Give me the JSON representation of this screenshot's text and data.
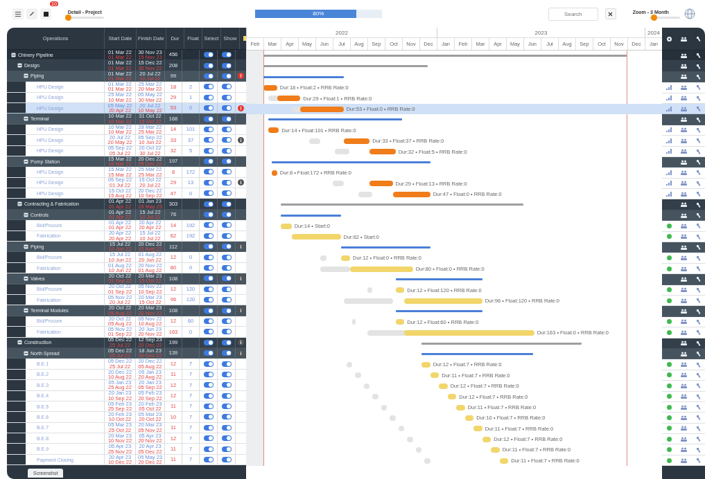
{
  "toolbar": {
    "notification_count": "10",
    "detail": {
      "label": "Detail - Project",
      "level": 0
    },
    "progress": {
      "text": "80%",
      "level": 0.8
    },
    "search": {
      "placeholder": "Search"
    },
    "zoom": {
      "label": "Zoom - 3 Month",
      "level": 0.15
    }
  },
  "columns": [
    "Operations",
    "Start Date",
    "Finish Date",
    "Dur",
    "Float",
    "Select",
    "Show"
  ],
  "timeline": [
    {
      "label": "2022",
      "months": [
        "Feb",
        "Mar",
        "Apr",
        "May",
        "Jun",
        "Jul",
        "Aug",
        "Sep",
        "Oct",
        "Nov",
        "Dec"
      ]
    },
    {
      "label": "2023",
      "months": [
        "Jan",
        "Feb",
        "Mar",
        "Apr",
        "May",
        "Jun",
        "Jul",
        "Aug",
        "Sep",
        "Oct",
        "Nov",
        "Dec"
      ]
    },
    {
      "label": "2024",
      "months": [
        "Jan"
      ]
    }
  ],
  "rows": [
    {
      "kind": "group",
      "name": "Chinery Pipeline",
      "expanded": true,
      "selected": false,
      "start": "01 Mar 22",
      "start_base": "01 Mar 22",
      "finish": "30 Nov 23",
      "finish_base": "15 Nov 23",
      "dur": "456",
      "select": true,
      "show": true,
      "children": [
        {
          "kind": "group",
          "name": "Design",
          "expanded": true,
          "selected": false,
          "start": "01 Mar 22",
          "start_base": "01 Mar 22",
          "finish": "15 Dec 22",
          "finish_base": "30 Nov 22",
          "dur": "208",
          "select": true,
          "show": true,
          "children": [
            {
              "kind": "group",
              "name": "Piping",
              "expanded": true,
              "selected": false,
              "start": "01 Mar 22",
              "start_base": "01 Mar 22",
              "finish": "20 Jul 22",
              "finish_base": "10 Jul 22",
              "dur": "99",
              "select": true,
              "show": true,
              "badge": {
                "kind": "alert"
              },
              "children": [
                {
                  "kind": "task",
                  "name": "HPU Design",
                  "selected": false,
                  "start": "01 Mar 22",
                  "start_base": "01 Mar 22",
                  "finish": "25 Mar 22",
                  "finish_base": "20 Mar 22",
                  "dur": "18",
                  "float": "2",
                  "select": true,
                  "show": true,
                  "approved": false,
                  "color": "#f07c1a",
                  "bar_label": "Dur:18 • Float:2 • RRB Rate:0"
                },
                {
                  "kind": "task",
                  "name": "HPU Design",
                  "selected": false,
                  "start": "25 Mar 22",
                  "start_base": "10 Mar 22",
                  "finish": "05 May 22",
                  "finish_base": "30 Mar 22",
                  "dur": "29",
                  "float": "1",
                  "select": true,
                  "show": true,
                  "approved": false,
                  "color": "#f07c1a",
                  "bar_label": "Dur:29 • Float:1 • RRB Rate:0"
                },
                {
                  "kind": "task",
                  "name": "HPU Design",
                  "selected": true,
                  "start": "05 May 22",
                  "start_base": "20 Apr 22",
                  "finish": "20 Jul 22",
                  "finish_base": "10 May 22",
                  "dur": "53",
                  "float": "0",
                  "select": true,
                  "show": true,
                  "approved": false,
                  "badge": {
                    "kind": "alert"
                  },
                  "color": "#f07c1a",
                  "bar_label": "Dur:53 • Float:0 • RRB Rate:0"
                }
              ]
            },
            {
              "kind": "group",
              "name": "Terminal",
              "expanded": true,
              "selected": false,
              "start": "10 Mar 22",
              "start_base": "10 Mar 22",
              "finish": "31 Oct 22",
              "finish_base": "15 Oct 22",
              "dur": "168",
              "select": true,
              "show": true,
              "children": [
                {
                  "kind": "task",
                  "name": "HPU Design",
                  "selected": false,
                  "start": "10 Mar 22",
                  "start_base": "10 Mar 22",
                  "finish": "28 Mar 22",
                  "finish_base": "25 Mar 22",
                  "dur": "14",
                  "float": "101",
                  "select": true,
                  "show": true,
                  "approved": false,
                  "color": "#f07c1a",
                  "bar_label": "Dur:14 • Float:101 • RRB Rate:0"
                },
                {
                  "kind": "task",
                  "name": "HPU Design",
                  "selected": false,
                  "start": "20 Jul 22",
                  "start_base": "20 May 22",
                  "finish": "05 Sep 22",
                  "finish_base": "10 Jun 22",
                  "dur": "33",
                  "float": "37",
                  "select": true,
                  "show": true,
                  "approved": false,
                  "badge": {
                    "kind": "info"
                  },
                  "color": "#f07c1a",
                  "bar_label": "Dur:33 • Float:37 • RRB Rate:0"
                },
                {
                  "kind": "task",
                  "name": "HPU Design",
                  "selected": false,
                  "start": "05 Sep 22",
                  "start_base": "05 Jul 22",
                  "finish": "20 Oct 22",
                  "finish_base": "30 Jul 22",
                  "dur": "32",
                  "float": "5",
                  "select": true,
                  "show": true,
                  "approved": false,
                  "color": "#f07c1a",
                  "bar_label": "Dur:32 • Float:5 • RRB Rate:0"
                }
              ]
            },
            {
              "kind": "group",
              "name": "Pump Station",
              "expanded": true,
              "selected": false,
              "start": "15 Mar 22",
              "start_base": "15 Mar 22",
              "finish": "20 Dec 22",
              "finish_base": "05 Dec 22",
              "dur": "197",
              "select": true,
              "show": true,
              "children": [
                {
                  "kind": "task",
                  "name": "HPU Design",
                  "selected": false,
                  "start": "15 Mar 22",
                  "start_base": "15 Mar 22",
                  "finish": "25 Mar 22",
                  "finish_base": "25 Mar 22",
                  "dur": "8",
                  "float": "172",
                  "select": true,
                  "show": true,
                  "approved": false,
                  "color": "#f07c1a",
                  "bar_label": "Dur:8 • Float:172 • RRB Rate:0"
                },
                {
                  "kind": "task",
                  "name": "HPU Design",
                  "selected": false,
                  "start": "05 Sep 22",
                  "start_base": "01 Jul 22",
                  "finish": "15 Oct 22",
                  "finish_base": "20 Jul 22",
                  "dur": "29",
                  "float": "13",
                  "select": true,
                  "show": true,
                  "approved": false,
                  "badge": {
                    "kind": "info"
                  },
                  "color": "#f07c1a",
                  "bar_label": "Dur:29 • Float:13 • RRB Rate:0"
                },
                {
                  "kind": "task",
                  "name": "HPU Design",
                  "selected": false,
                  "start": "15 Oct 22",
                  "start_base": "15 Aug 22",
                  "finish": "20 Dec 22",
                  "finish_base": "10 Sep 22",
                  "dur": "47",
                  "float": "0",
                  "select": true,
                  "show": true,
                  "approved": false,
                  "color": "#f07c1a",
                  "bar_label": "Dur:47 • Float:0 • RRB Rate:0"
                }
              ]
            }
          ]
        },
        {
          "kind": "group",
          "name": "Contracting & Fabrication",
          "expanded": true,
          "selected": false,
          "start": "01 Apr 22",
          "start_base": "01 Apr 22",
          "finish": "01 Jun 23",
          "finish_base": "15 May 23",
          "dur": "303",
          "select": true,
          "show": true,
          "children": [
            {
              "kind": "group",
              "name": "Controls",
              "expanded": true,
              "selected": false,
              "start": "01 Apr 22",
              "start_base": "01 Apr 22",
              "finish": "15 Jul 22",
              "finish_base": "10 Jul 22",
              "dur": "76",
              "select": true,
              "show": true,
              "children": [
                {
                  "kind": "task",
                  "name": "Bid/Procure",
                  "selected": false,
                  "start": "01 Apr 22",
                  "start_base": "01 Apr 22",
                  "finish": "20 Apr 22",
                  "finish_base": "20 Apr 22",
                  "dur": "14",
                  "float": "192",
                  "select": true,
                  "show": true,
                  "approved": true,
                  "color": "#f2d66b",
                  "bar_label": "Dur:14 • Start:0"
                },
                {
                  "kind": "task",
                  "name": "Fabrication",
                  "selected": false,
                  "start": "20 Apr 22",
                  "start_base": "20 Apr 22",
                  "finish": "15 Jul 22",
                  "finish_base": "10 Jul 22",
                  "dur": "62",
                  "float": "192",
                  "select": true,
                  "show": true,
                  "approved": true,
                  "color": "#f2d66b",
                  "bar_label": "Dur:62 • Start:0"
                }
              ]
            },
            {
              "kind": "group",
              "name": "Piping",
              "expanded": true,
              "selected": false,
              "start": "15 Jul 22",
              "start_base": "10 Jun 22",
              "finish": "20 Dec 22",
              "finish_base": "01 Aug 22",
              "dur": "112",
              "select": true,
              "show": true,
              "badge": {
                "kind": "info"
              },
              "children": [
                {
                  "kind": "task",
                  "name": "Bid/Procure",
                  "selected": false,
                  "start": "15 Jul 22",
                  "start_base": "10 Jun 22",
                  "finish": "01 Aug 22",
                  "finish_base": "20 Jun 22",
                  "dur": "12",
                  "float": "0",
                  "select": true,
                  "show": true,
                  "approved": true,
                  "color": "#f2d66b",
                  "bar_label": "Dur:12 • Float:0 • RRB Rate:0"
                },
                {
                  "kind": "task",
                  "name": "Fabrication",
                  "selected": false,
                  "start": "01 Aug 22",
                  "start_base": "10 Jun 22",
                  "finish": "20 Nov 22",
                  "finish_base": "01 Aug 22",
                  "dur": "80",
                  "float": "0",
                  "select": true,
                  "show": true,
                  "approved": true,
                  "color": "#f2d66b",
                  "bar_label": "Dur:80 • Float:0 • RRB Rate:0"
                }
              ]
            },
            {
              "kind": "group",
              "name": "Valves",
              "expanded": true,
              "selected": false,
              "start": "20 Oct 22",
              "start_base": "01 Sep 22",
              "finish": "20 Mar 23",
              "finish_base": "15 Oct 22",
              "dur": "108",
              "select": true,
              "show": true,
              "badge": {
                "kind": "info"
              },
              "children": [
                {
                  "kind": "task",
                  "name": "Bid/Procure",
                  "selected": false,
                  "start": "20 Oct 22",
                  "start_base": "01 Sep 22",
                  "finish": "05 Nov 22",
                  "finish_base": "10 Sep 22",
                  "dur": "12",
                  "float": "120",
                  "select": true,
                  "show": true,
                  "approved": true,
                  "color": "#f2d66b",
                  "bar_label": "Dur:12 • Float:120 • RRB Rate:0"
                },
                {
                  "kind": "task",
                  "name": "Fabrication",
                  "selected": false,
                  "start": "05 Nov 22",
                  "start_base": "20 Jul 22",
                  "finish": "20 Mar 23",
                  "finish_base": "15 Oct 22",
                  "dur": "96",
                  "float": "120",
                  "select": true,
                  "show": true,
                  "approved": true,
                  "color": "#f2d66b",
                  "bar_label": "Dur:96 • Float:120 • RRB Rate:0"
                }
              ]
            },
            {
              "kind": "group",
              "name": "Terminal Modules",
              "expanded": true,
              "selected": false,
              "start": "20 Oct 22",
              "start_base": "05 Aug 22",
              "finish": "20 Mar 23",
              "finish_base": "20 Nov 22",
              "dur": "108",
              "select": true,
              "show": true,
              "badge": {
                "kind": "info"
              },
              "children": [
                {
                  "kind": "task",
                  "name": "Bid/Procure",
                  "selected": false,
                  "start": "20 Oct 22",
                  "start_base": "05 Aug 22",
                  "finish": "05 Nov 22",
                  "finish_base": "10 Aug 22",
                  "dur": "12",
                  "float": "60",
                  "select": true,
                  "show": true,
                  "approved": true,
                  "color": "#f2d66b",
                  "bar_label": "Dur:12 • Float:60 • RRB Rate:0"
                },
                {
                  "kind": "task",
                  "name": "Fabrication",
                  "selected": false,
                  "start": "05 Nov 22",
                  "start_base": "01 Sep 22",
                  "finish": "20 Jun 23",
                  "finish_base": "20 Nov 22",
                  "dur": "163",
                  "float": "0",
                  "select": true,
                  "show": true,
                  "approved": true,
                  "color": "#f2d66b",
                  "bar_label": "Dur:163 • Float:0 • RRB Rate:0"
                }
              ]
            }
          ]
        },
        {
          "kind": "group",
          "name": "Construction",
          "expanded": true,
          "selected": false,
          "start": "05 Dec 22",
          "start_base": "25 Jul 22",
          "finish": "12 Sep 23",
          "finish_base": "20 Dec 22",
          "dur": "199",
          "select": true,
          "show": true,
          "badge": {
            "kind": "info"
          },
          "children": [
            {
              "kind": "group",
              "name": "North Spread",
              "expanded": true,
              "selected": false,
              "start": "05 Dec 22",
              "start_base": "25 Jul 22",
              "finish": "18 Jun 23",
              "finish_base": "20 Dec 22",
              "dur": "139",
              "select": true,
              "show": true,
              "badge": {
                "kind": "info"
              },
              "children": [
                {
                  "kind": "task",
                  "name": "B.E.1",
                  "selected": false,
                  "start": "05 Dec 22",
                  "start_base": "25 Jul 22",
                  "finish": "20 Dec 22",
                  "finish_base": "05 Aug 22",
                  "dur": "12",
                  "float": "7",
                  "select": true,
                  "show": true,
                  "approved": true,
                  "color": "#f2d66b",
                  "bar_label": "Dur:12 • Float:7 • RRB Rate:0"
                },
                {
                  "kind": "task",
                  "name": "B.E.2",
                  "selected": false,
                  "start": "20 Dec 22",
                  "start_base": "10 Aug 22",
                  "finish": "05 Jan 23",
                  "finish_base": "20 Aug 22",
                  "dur": "11",
                  "float": "7",
                  "select": true,
                  "show": true,
                  "approved": true,
                  "color": "#f2d66b",
                  "bar_label": "Dur:11 • Float:7 • RRB Rate:0"
                },
                {
                  "kind": "task",
                  "name": "B.E.3",
                  "selected": false,
                  "start": "05 Jan 23",
                  "start_base": "25 Aug 22",
                  "finish": "20 Jan 23",
                  "finish_base": "05 Sep 22",
                  "dur": "12",
                  "float": "7",
                  "select": true,
                  "show": true,
                  "approved": true,
                  "color": "#f2d66b",
                  "bar_label": "Dur:12 • Float:7 • RRB Rate:0"
                },
                {
                  "kind": "task",
                  "name": "B.E.4",
                  "selected": false,
                  "start": "20 Jan 23",
                  "start_base": "10 Sep 22",
                  "finish": "05 Feb 23",
                  "finish_base": "20 Sep 22",
                  "dur": "12",
                  "float": "7",
                  "select": true,
                  "show": true,
                  "approved": true,
                  "color": "#f2d66b",
                  "bar_label": "Dur:12 • Float:7 • RRB Rate:0"
                },
                {
                  "kind": "task",
                  "name": "B.E.5",
                  "selected": false,
                  "start": "05 Feb 23",
                  "start_base": "25 Sep 22",
                  "finish": "20 Feb 23",
                  "finish_base": "05 Oct 22",
                  "dur": "11",
                  "float": "7",
                  "select": true,
                  "show": true,
                  "approved": true,
                  "color": "#f2d66b",
                  "bar_label": "Dur:11 • Float:7 • RRB Rate:0"
                },
                {
                  "kind": "task",
                  "name": "B.E.6",
                  "selected": false,
                  "start": "20 Feb 23",
                  "start_base": "10 Oct 22",
                  "finish": "05 Mar 23",
                  "finish_base": "20 Oct 22",
                  "dur": "10",
                  "float": "7",
                  "select": true,
                  "show": true,
                  "approved": true,
                  "color": "#f2d66b",
                  "bar_label": "Dur:10 • Float:7 • RRB Rate:0"
                },
                {
                  "kind": "task",
                  "name": "B.E.7",
                  "selected": false,
                  "start": "05 Mar 23",
                  "start_base": "25 Oct 22",
                  "finish": "20 Mar 23",
                  "finish_base": "05 Nov 22",
                  "dur": "11",
                  "float": "7",
                  "select": true,
                  "show": true,
                  "approved": true,
                  "color": "#f2d66b",
                  "bar_label": "Dur:11 • Float:7 • RRB Rate:0"
                },
                {
                  "kind": "task",
                  "name": "B.E.8",
                  "selected": false,
                  "start": "20 Mar 23",
                  "start_base": "10 Nov 22",
                  "finish": "05 Apr 23",
                  "finish_base": "20 Nov 22",
                  "dur": "12",
                  "float": "7",
                  "select": true,
                  "show": true,
                  "approved": true,
                  "color": "#f2d66b",
                  "bar_label": "Dur:12 • Float:7 • RRB Rate:0"
                },
                {
                  "kind": "task",
                  "name": "B.E.9",
                  "selected": false,
                  "start": "05 Apr 23",
                  "start_base": "25 Nov 22",
                  "finish": "20 Apr 23",
                  "finish_base": "05 Dec 22",
                  "dur": "11",
                  "float": "7",
                  "select": true,
                  "show": true,
                  "approved": true,
                  "color": "#f2d66b",
                  "bar_label": "Dur:11 • Float:7 • RRB Rate:0"
                },
                {
                  "kind": "task",
                  "name": "Payment Closing",
                  "selected": false,
                  "start": "20 Apr 23",
                  "start_base": "10 Dec 22",
                  "finish": "05 May 23",
                  "finish_base": "20 Dec 22",
                  "dur": "11",
                  "float": "7",
                  "select": true,
                  "show": true,
                  "approved": true,
                  "color": "#f2d66b",
                  "bar_label": "Dur:11 • Float:7 • RRB Rate:0"
                }
              ]
            }
          ]
        }
      ]
    }
  ],
  "footer_tab": "Screenshot"
}
